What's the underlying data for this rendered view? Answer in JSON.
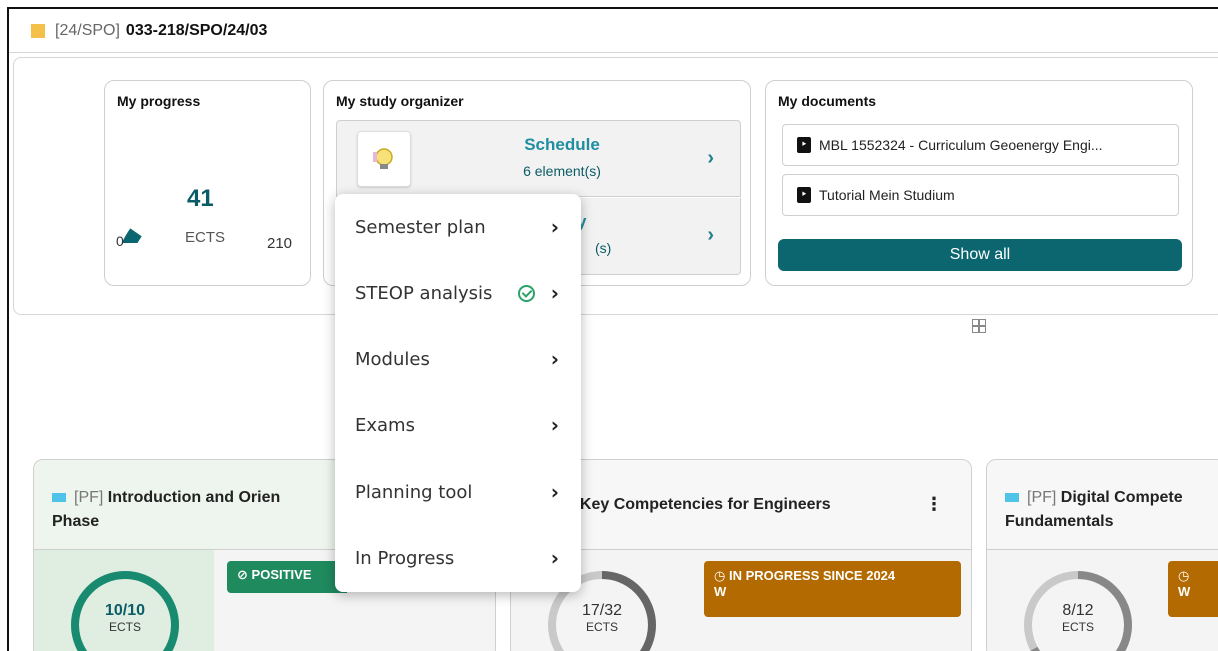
{
  "header": {
    "code": "[24/SPO]",
    "title": "033-218/SPO/24/03"
  },
  "progress": {
    "title": "My progress",
    "value": "41",
    "unit": "ECTS",
    "min": "0",
    "max": "210",
    "fraction": 0.195
  },
  "organizer": {
    "title": "My study organizer",
    "rows": [
      {
        "name": "Schedule",
        "count": "6 element(s)"
      },
      {
        "name": "y",
        "count": "(s)"
      }
    ]
  },
  "documents": {
    "title": "My documents",
    "items": [
      {
        "label": "MBL 1552324 - Curriculum Geoenergy Engi..."
      },
      {
        "label": "Tutorial Mein Studium"
      }
    ],
    "show_all": "Show all"
  },
  "menu": {
    "items": [
      {
        "label": "Semester plan"
      },
      {
        "label": "STEOP analysis"
      },
      {
        "label": "Modules"
      },
      {
        "label": "Exams"
      },
      {
        "label": "Planning tool"
      },
      {
        "label": "In Progress"
      }
    ]
  },
  "modules": [
    {
      "tag": "[PF]",
      "title_l1": "Introduction and Orien",
      "title_l2": "Phase",
      "ects": "10/10",
      "unit": "ECTS",
      "badge": "POSITIVE",
      "fraction": 1.0
    },
    {
      "tag": "]",
      "title_l1": "Key Competencies for Engineers",
      "title_l2": "",
      "ects": "17/32",
      "unit": "ECTS",
      "badge_l1": "IN PROGRESS SINCE 2024",
      "badge_l2": "W",
      "fraction": 0.53
    },
    {
      "tag": "[PF]",
      "title_l1": "Digital Compete",
      "title_l2": "Fundamentals",
      "ects": "8/12",
      "unit": "ECTS",
      "badge_l1": "",
      "badge_l2": "W",
      "fraction": 0.67
    }
  ],
  "colors": {
    "accent": "#0c6670",
    "teal_text": "#1f8ea0",
    "positive": "#1f8a5e",
    "in_progress": "#b36a00",
    "spo_square": "#f5c04a",
    "pf_square": "#4fc3e8"
  }
}
